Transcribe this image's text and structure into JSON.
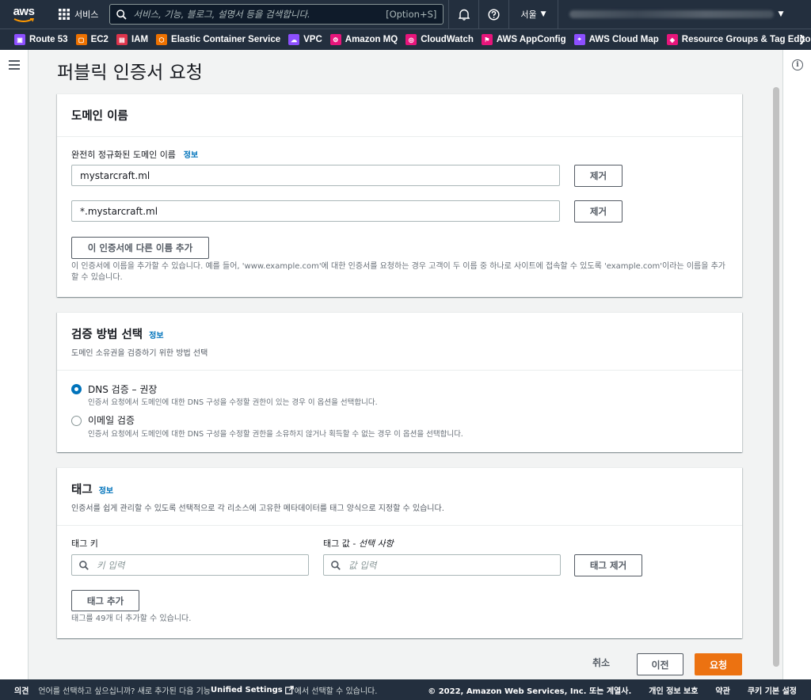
{
  "topnav": {
    "logo_text": "aws",
    "services_label": "서비스",
    "search_placeholder": "서비스, 기능, 블로그, 설명서 등을 검색합니다.",
    "search_shortcut": "[Option+S]",
    "region_label": "서울"
  },
  "favorites": [
    {
      "label": "Route 53",
      "color": "#8c4fff",
      "icon": "route53-icon"
    },
    {
      "label": "EC2",
      "color": "#ed7100",
      "icon": "ec2-icon"
    },
    {
      "label": "IAM",
      "color": "#dd344c",
      "icon": "iam-icon"
    },
    {
      "label": "Elastic Container Service",
      "color": "#ed7100",
      "icon": "ecs-icon"
    },
    {
      "label": "VPC",
      "color": "#8c4fff",
      "icon": "vpc-icon"
    },
    {
      "label": "Amazon MQ",
      "color": "#e7157b",
      "icon": "mq-icon"
    },
    {
      "label": "CloudWatch",
      "color": "#e7157b",
      "icon": "cloudwatch-icon"
    },
    {
      "label": "AWS AppConfig",
      "color": "#e7157b",
      "icon": "appconfig-icon"
    },
    {
      "label": "AWS Cloud Map",
      "color": "#8c4fff",
      "icon": "cloudmap-icon"
    },
    {
      "label": "Resource Groups & Tag Editor",
      "color": "#e7157b",
      "icon": "resource-groups-icon"
    }
  ],
  "page": {
    "title": "퍼블릭 인증서 요청"
  },
  "domain_card": {
    "title": "도메인 이름",
    "fqdn_label": "완전히 정규화된 도메인 이름",
    "info": "정보",
    "domains": [
      "mystarcraft.ml",
      "*.mystarcraft.ml"
    ],
    "remove_label": "제거",
    "add_name_label": "이 인증서에 다른 이름 추가",
    "hint": "이 인증서에 이름을 추가할 수 있습니다. 예를 들어, 'www.example.com'에 대한 인증서를 요청하는 경우 고객이 두 이름 중 하나로 사이트에 접속할 수 있도록 'example.com'이라는 이름을 추가할 수 있습니다."
  },
  "validation_card": {
    "title": "검증 방법 선택",
    "info": "정보",
    "desc": "도메인 소유권을 검증하기 위한 방법 선택",
    "options": [
      {
        "title": "DNS 검증 – 권장",
        "desc": "인증서 요청에서 도메인에 대한 DNS 구성을 수정할 권한이 있는 경우 이 옵션을 선택합니다.",
        "selected": true
      },
      {
        "title": "이메일 검증",
        "desc": "인증서 요청에서 도메인에 대한 DNS 구성을 수정할 권한을 소유하지 않거나 획득할 수 없는 경우 이 옵션을 선택합니다.",
        "selected": false
      }
    ]
  },
  "tags_card": {
    "title": "태그",
    "info": "정보",
    "desc": "인증서를 쉽게 관리할 수 있도록 선택적으로 각 리소스에 고유한 메타데이터를 태그 양식으로 지정할 수 있습니다.",
    "key_label": "태그 키",
    "value_label": "태그 값 - ",
    "value_optional": "선택 사항",
    "key_placeholder": "키 입력",
    "value_placeholder": "값 입력",
    "remove_tag_label": "태그 제거",
    "add_tag_label": "태그 추가",
    "hint": "태그를 49개 더 추가할 수 있습니다."
  },
  "actions": {
    "cancel": "취소",
    "previous": "이전",
    "request": "요청"
  },
  "bottombar": {
    "feedback": "의견",
    "message_pre": "언어를 선택하고 싶으십니까? 새로 추가된 다음 기능",
    "message_link": "Unified Settings",
    "message_post": "에서 선택할 수 있습니다.",
    "copyright": "© 2022, Amazon Web Services, Inc. 또는 계열사.",
    "privacy": "개인 정보 보호",
    "terms": "약관",
    "cookies": "쿠키 기본 설정"
  }
}
